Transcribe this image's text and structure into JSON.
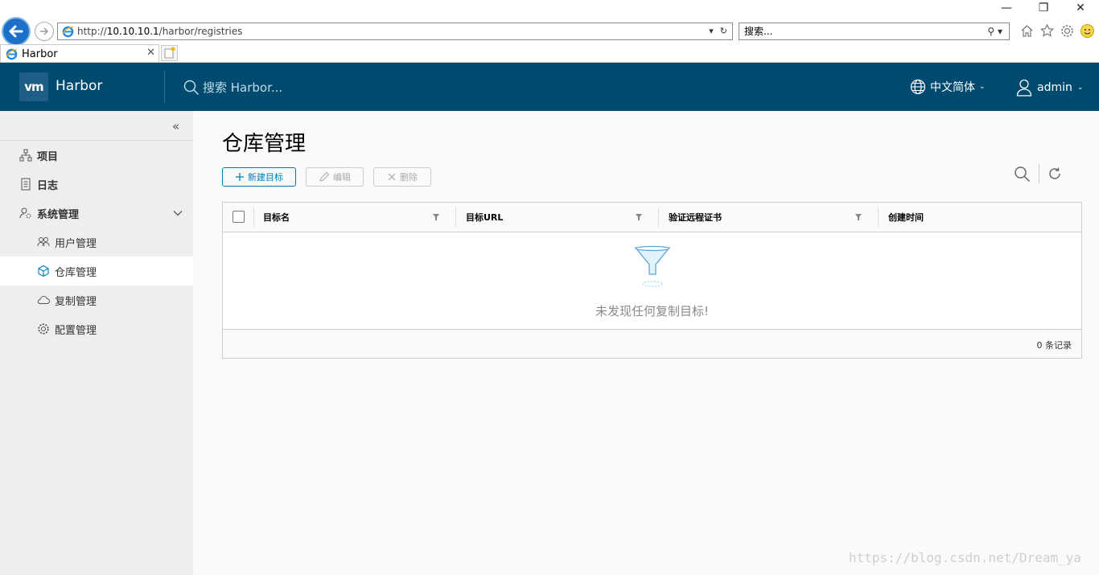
{
  "browser": {
    "url_prefix": "http://",
    "url_host": "10.10.10.1",
    "url_path": "/harbor/registries",
    "search_placeholder": "搜索...",
    "tab_title": "Harbor"
  },
  "header": {
    "logo": "vm",
    "brand": "Harbor",
    "search_placeholder": "搜索 Harbor...",
    "language": "中文简体",
    "user": "admin"
  },
  "sidebar": {
    "projects": "项目",
    "logs": "日志",
    "admin": "系统管理",
    "users": "用户管理",
    "registries": "仓库管理",
    "replication": "复制管理",
    "config": "配置管理"
  },
  "main": {
    "title": "仓库管理",
    "new_target": "新建目标",
    "edit": "编辑",
    "delete": "删除"
  },
  "grid": {
    "col_name": "目标名",
    "col_url": "目标URL",
    "col_verify": "验证远程证书",
    "col_created": "创建时间",
    "empty": "未发现任何复制目标!",
    "footer": "0 条记录"
  },
  "watermark": "https://blog.csdn.net/Dream_ya",
  "colors": {
    "header_bg": "#004a70",
    "primary": "#0079b8"
  }
}
